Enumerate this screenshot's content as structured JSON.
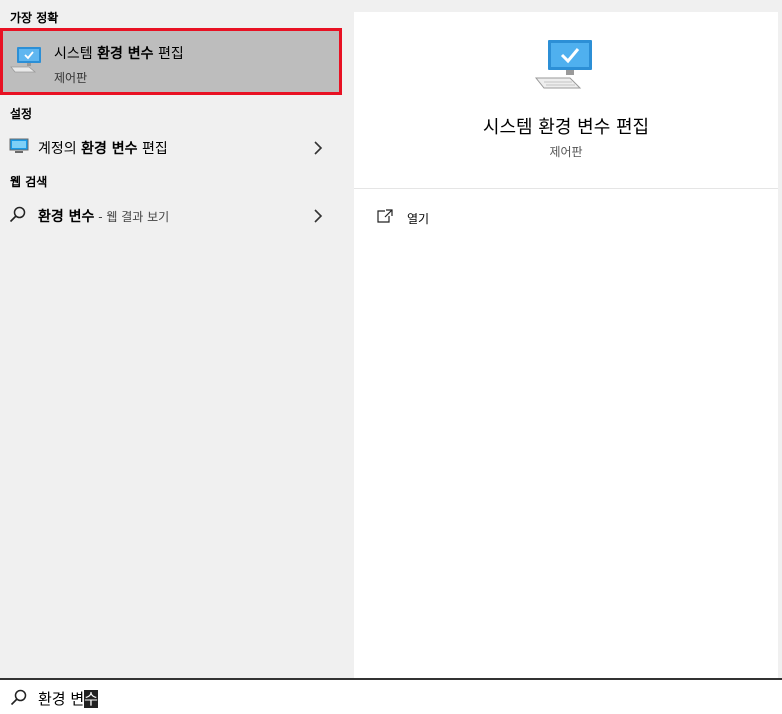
{
  "left_panel": {
    "best_match_header": "가장 정확",
    "best_match": {
      "title_pre": "시스템 ",
      "title_bold": "환경 변수",
      "title_post": " 편집",
      "subtitle": "제어판",
      "icon": "pc-monitor-icon"
    },
    "settings_header": "설정",
    "settings_items": [
      {
        "pre": "계정의 ",
        "bold": "환경 변수",
        "post": " 편집",
        "icon": "settings-monitor-icon"
      }
    ],
    "web_header": "웹 검색",
    "web_items": [
      {
        "bold": "환경 변수",
        "suffix": " - 웹 결과 보기",
        "icon": "search-icon"
      }
    ]
  },
  "detail_panel": {
    "title": "시스템 환경 변수 편집",
    "subtitle": "제어판",
    "actions": [
      {
        "label": "열기",
        "icon": "open-icon"
      }
    ]
  },
  "search_bar": {
    "query_typed": "환경 변",
    "query_composing": "수",
    "icon": "search-icon"
  },
  "colors": {
    "highlight_border": "#e81123",
    "selected_bg": "#bdbdbd",
    "panel_bg": "#f0f0f0",
    "accent_blue": "#1a9be8"
  }
}
